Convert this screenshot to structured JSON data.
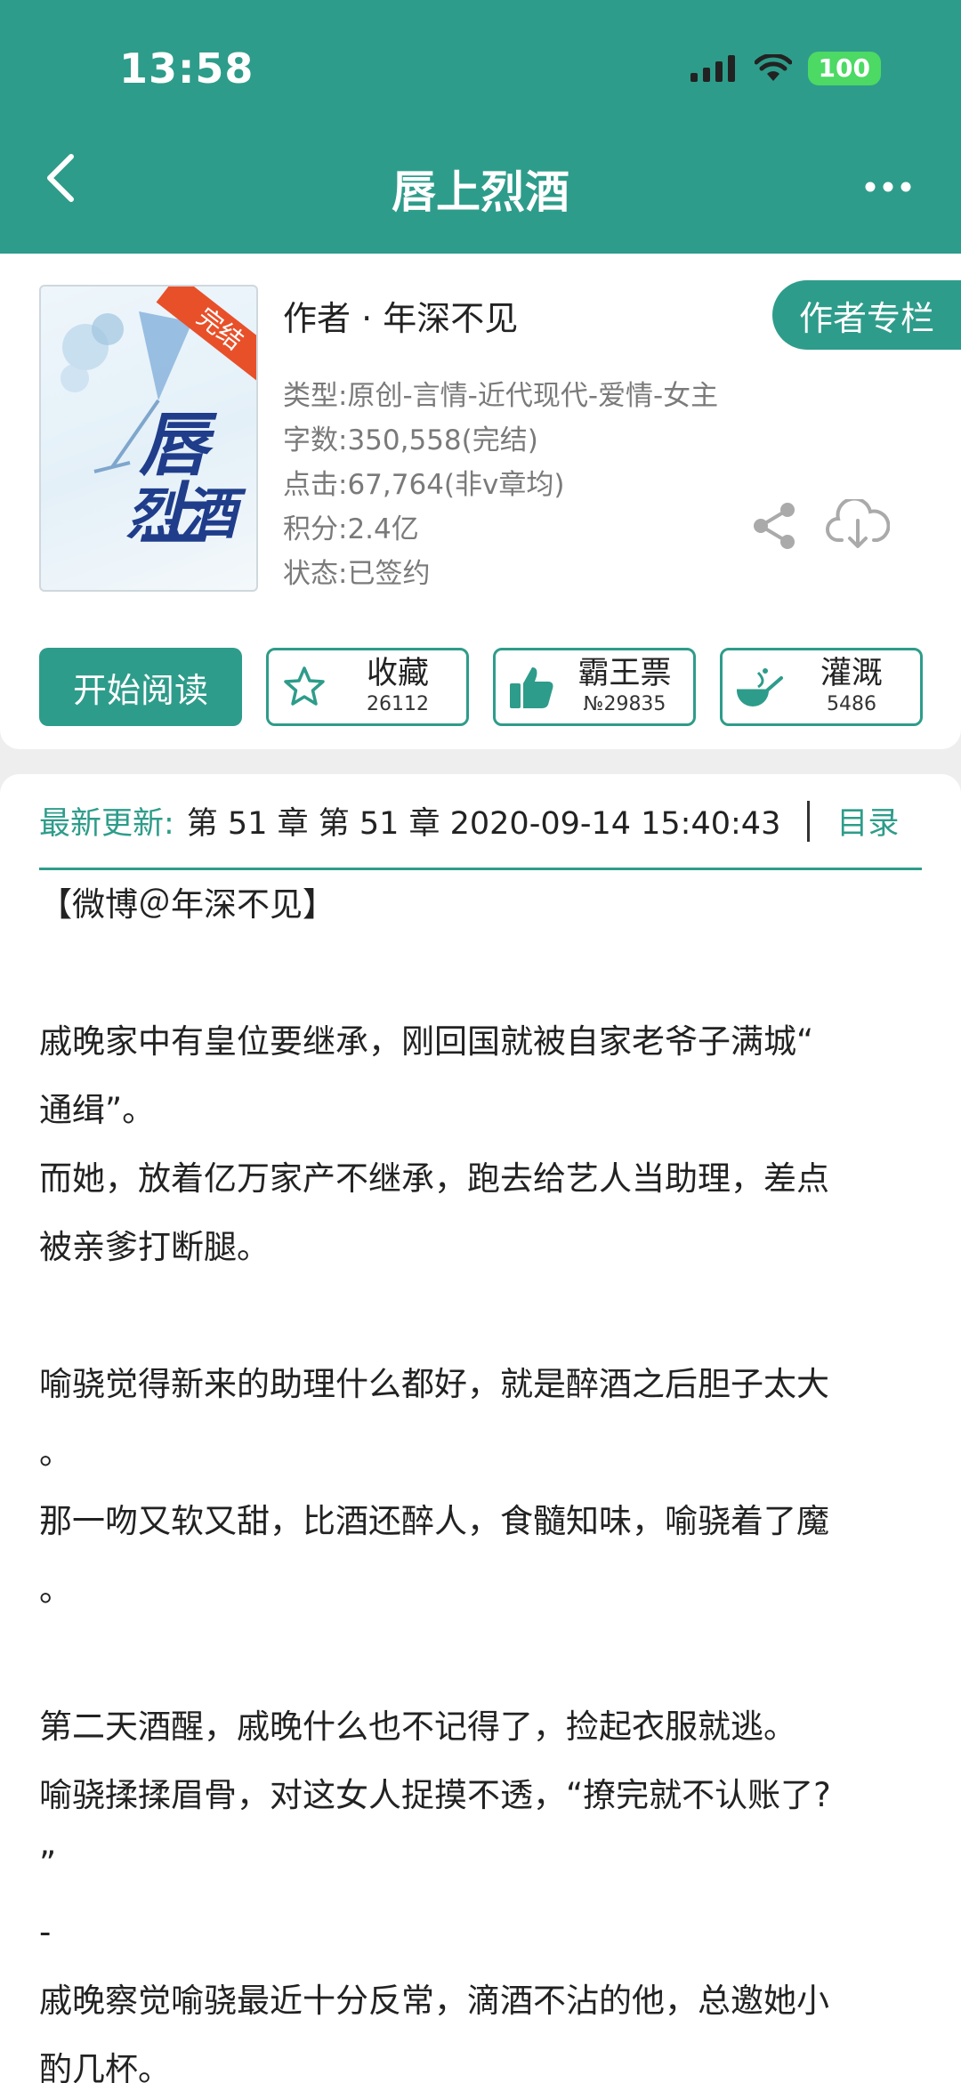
{
  "status": {
    "time": "13:58",
    "battery": "100"
  },
  "header": {
    "title": "唇上烈酒"
  },
  "book": {
    "cover_title_line1": "唇上",
    "cover_title_line2": "烈酒",
    "cover_badge": "完结",
    "author_line": "作者 · 年深不见",
    "author_column_label": "作者专栏",
    "meta": [
      "类型:原创-言情-近代现代-爱情-女主",
      "字数:350,558(完结)",
      "点击:67,764(非v章均)",
      "积分:2.4亿",
      "状态:已签约"
    ]
  },
  "actions": {
    "read_label": "开始阅读",
    "collect": {
      "label": "收藏",
      "count": "26112"
    },
    "vote": {
      "label": "霸王票",
      "count": "№29835"
    },
    "water": {
      "label": "灌溉",
      "count": "5486"
    }
  },
  "update": {
    "label": "最新更新:",
    "text": "第 51 章 第 51 章 2020-09-14 15:40:43",
    "toc_label": "目录"
  },
  "intro_lines": [
    "【微博＠年深不见】",
    "",
    "戚晚家中有皇位要继承，刚回国就被自家老爷子满城“",
    "通缉”。",
    "而她，放着亿万家产不继承，跑去给艺人当助理，差点",
    "被亲爹打断腿。",
    "",
    "喻骁觉得新来的助理什么都好，就是醉酒之后胆子太大",
    "。",
    "那一吻又软又甜，比酒还醉人，食髓知味，喻骁着了魔",
    "。",
    "",
    "第二天酒醒，戚晚什么也不记得了，捡起衣服就逃。",
    "喻骁揉揉眉骨，对这女人捉摸不透，“撩完就不认账了?",
    "”",
    "-",
    "戚晚察觉喻骁最近十分反常，滴酒不沾的他，总邀她小",
    "酌几杯。"
  ],
  "colors": {
    "accent": "#2e9c8a",
    "battery": "#4cd964",
    "badge": "#e8502a"
  },
  "icons": [
    "back-arrow-icon",
    "more-dots-icon",
    "share-icon",
    "download-icon",
    "star-icon",
    "thumbs-up-icon",
    "watering-icon"
  ]
}
